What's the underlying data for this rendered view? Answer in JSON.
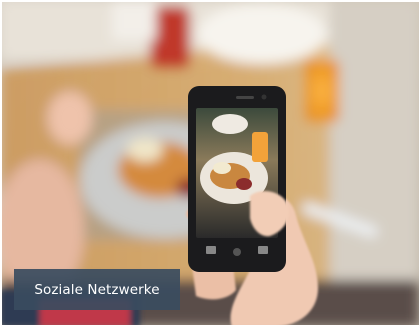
{
  "caption": {
    "label": "Soziale Netzwerke"
  },
  "photo": {
    "subject": "hands-holding-smartphone-photographing-food-icon"
  },
  "colors": {
    "caption_bg": "#3A4C60",
    "caption_text": "#FFFFFF"
  }
}
